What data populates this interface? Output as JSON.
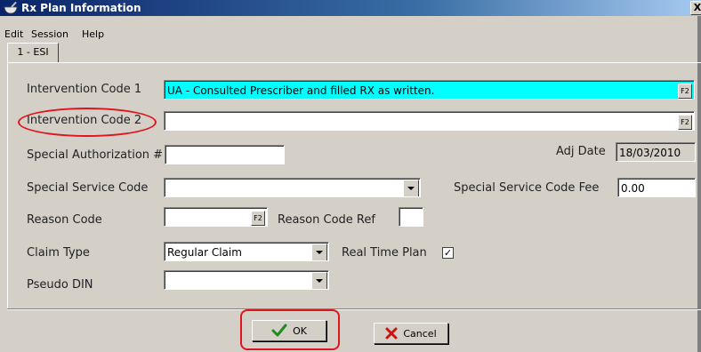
{
  "window": {
    "title": "Rx Plan Information",
    "close_glyph": "X"
  },
  "menu": {
    "items": [
      "Edit",
      "Session",
      "Help"
    ]
  },
  "tabs": [
    {
      "label": "1 - ESI",
      "active": true
    }
  ],
  "fields": {
    "intervention_code_1": {
      "label": "Intervention Code 1",
      "value": "UA - Consulted Prescriber and filled RX as written.",
      "lookup_key": "F2"
    },
    "intervention_code_2": {
      "label": "Intervention Code 2",
      "value": "",
      "lookup_key": "F2"
    },
    "special_authorization": {
      "label": "Special Authorization #",
      "value": ""
    },
    "adj_date": {
      "label": "Adj Date",
      "value": "18/03/2010"
    },
    "special_service_code": {
      "label": "Special Service Code",
      "value": ""
    },
    "special_service_code_fee": {
      "label": "Special Service Code Fee",
      "value": "0.00"
    },
    "reason_code": {
      "label": "Reason Code",
      "value": "",
      "lookup_key": "F2"
    },
    "reason_code_ref": {
      "label": "Reason Code Ref",
      "value": ""
    },
    "claim_type": {
      "label": "Claim Type",
      "value": "Regular Claim"
    },
    "real_time_plan": {
      "label": "Real Time Plan",
      "checked": true,
      "check_glyph": "✓"
    },
    "pseudo_din": {
      "label": "Pseudo DIN",
      "value": ""
    }
  },
  "buttons": {
    "ok": "OK",
    "cancel": "Cancel"
  },
  "icons": {
    "ok": "checkmark-icon",
    "cancel": "x-icon",
    "title": "mortar-pestle-icon"
  },
  "colors": {
    "highlight_field": "#00ffff",
    "annotation": "#e0141e",
    "ok_check": "#1e8c1e",
    "cancel_x": "#c81414"
  }
}
